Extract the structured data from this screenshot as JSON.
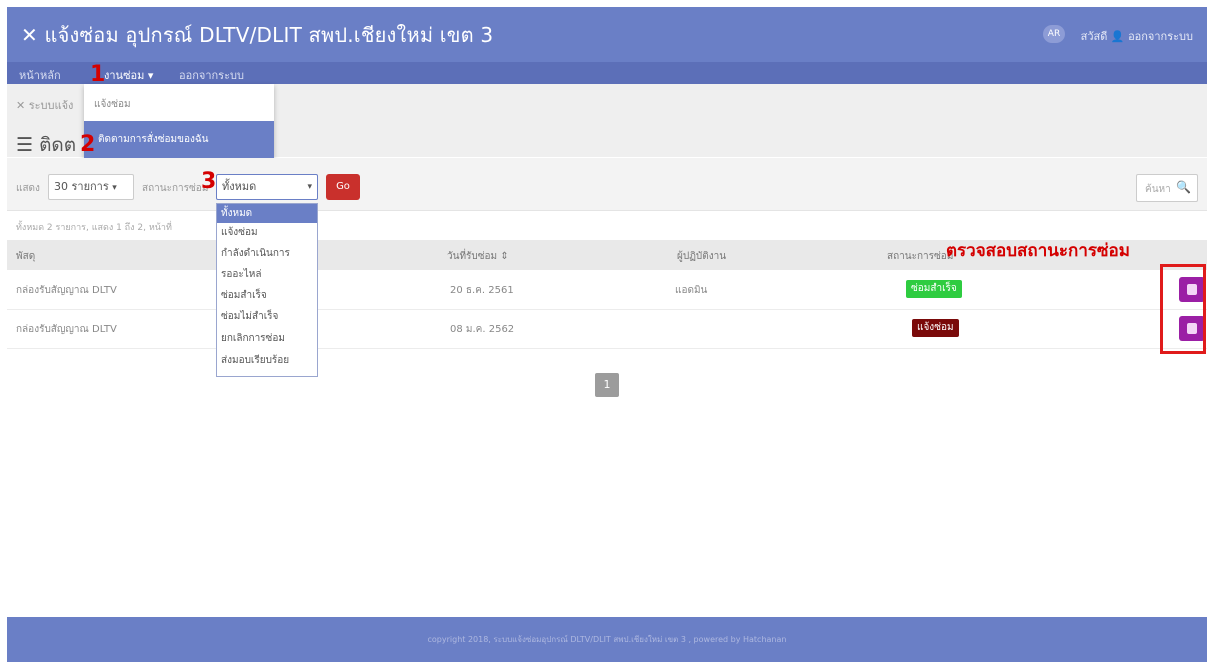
{
  "header": {
    "title": "แจ้งซ่อม อุปกรณ์ DLTV/DLIT สพป.เชียงใหม่ เขต 3",
    "user_badge": "AR",
    "user_name": "สวัสดี",
    "logout": "ออกจากระบบ"
  },
  "nav": {
    "home": "หน้าหลัก",
    "repair": "งานซ่อม",
    "logout": "ออกจากระบบ"
  },
  "breadcrumb": "ระบบแจ้ง",
  "page_title": "ติดต",
  "repair_menu": {
    "items": [
      "แจ้งซ่อม",
      "ติดตามการสั่งซ่อมของฉัน"
    ]
  },
  "markers": [
    "1",
    "2",
    "3"
  ],
  "filter": {
    "show_label": "แสดง",
    "show_value": "30 รายการ",
    "status_label": "สถานะการซ่อม",
    "status_value": "ทั้งหมด",
    "go_label": "Go",
    "search_placeholder": "ค้นหา"
  },
  "status_options": [
    "ทั้งหมด",
    "แจ้งซ่อม",
    "กำลังดำเนินการ",
    "รออะไหล่",
    "ซ่อมสำเร็จ",
    "ซ่อมไม่สำเร็จ",
    "ยกเลิกการซ่อม",
    "ส่งมอบเรียบร้อย"
  ],
  "summary": "ทั้งหมด 2 รายการ, แสดง 1 ถึง 2, หน้าที่",
  "table": {
    "headers": [
      "พัสดุ",
      "วันที่รับซ่อม ⇕",
      "ผู้ปฏิบัติงาน",
      "สถานะการซ่อม"
    ],
    "rows": [
      {
        "item": "กล่องรับสัญญาณ DLTV",
        "date": "20 ธ.ค. 2561",
        "worker": "แอดมิน",
        "status": "ซ่อมสำเร็จ",
        "status_color": "#2ecc40"
      },
      {
        "item": "กล่องรับสัญญาณ DLTV",
        "date": "08 ม.ค. 2562",
        "worker": "",
        "status": "แจ้งซ่อม",
        "status_color": "#7a0a0a"
      }
    ]
  },
  "annotation": "ตรวจสอบสถานะการซ่อม",
  "pagination": {
    "current": "1"
  },
  "footer": "copyright 2018, ระบบแจ้งซ่อมอุปกรณ์ DLTV/DLIT สพป.เชียงใหม่ เขต 3 , powered by Hatchanan"
}
